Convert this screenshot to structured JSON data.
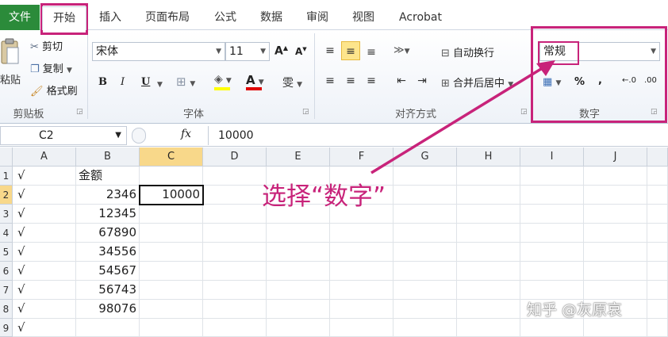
{
  "tabs": [
    {
      "id": "file",
      "label": "文件"
    },
    {
      "id": "home",
      "label": "开始"
    },
    {
      "id": "insert",
      "label": "插入"
    },
    {
      "id": "layout",
      "label": "页面布局"
    },
    {
      "id": "formula",
      "label": "公式"
    },
    {
      "id": "data",
      "label": "数据"
    },
    {
      "id": "review",
      "label": "审阅"
    },
    {
      "id": "view",
      "label": "视图"
    },
    {
      "id": "acrobat",
      "label": "Acrobat"
    }
  ],
  "clipboard": {
    "title": "剪贴板",
    "paste": "粘贴",
    "cut": "剪切",
    "copy": "复制",
    "format_painter": "格式刷"
  },
  "font": {
    "title": "字体",
    "name": "宋体",
    "size": "11",
    "bold": "B",
    "italic": "I",
    "underline": "U",
    "grow": "A",
    "shrink": "A",
    "color_letter": "A",
    "phonetic": "雯",
    "fill_color": "#ffff00",
    "font_color": "#e00000"
  },
  "alignment": {
    "title": "对齐方式",
    "wrap": "自动换行",
    "merge": "合并后居中"
  },
  "number": {
    "title": "数字",
    "format": "常规",
    "percent": "%",
    "comma": ",",
    "inc_decimal": "⁺.0⁠⁠.00",
    "inc_label": ".0",
    "dec_label": ".00"
  },
  "formula_bar": {
    "name_box": "C2",
    "fx": "fx",
    "value": "10000"
  },
  "grid": {
    "columns": [
      "A",
      "B",
      "C",
      "D",
      "E",
      "F",
      "G",
      "H",
      "I",
      "J"
    ],
    "selected_column": "C",
    "rows": [
      {
        "head": "1",
        "a": "√",
        "b": "金额",
        "c": ""
      },
      {
        "head": "2",
        "a": "√",
        "b": "2346",
        "c": "10000"
      },
      {
        "head": "3",
        "a": "√",
        "b": "12345",
        "c": ""
      },
      {
        "head": "4",
        "a": "√",
        "b": "67890",
        "c": ""
      },
      {
        "head": "5",
        "a": "√",
        "b": "34556",
        "c": ""
      },
      {
        "head": "6",
        "a": "√",
        "b": "54567",
        "c": ""
      },
      {
        "head": "7",
        "a": "√",
        "b": "56743",
        "c": ""
      },
      {
        "head": "8",
        "a": "√",
        "b": "98076",
        "c": ""
      },
      {
        "head": "9",
        "a": "√",
        "b": "",
        "c": ""
      }
    ]
  },
  "annotation": {
    "text": "选择“数字”",
    "color": "#c8237a"
  },
  "watermark": "知乎 @灰原哀"
}
